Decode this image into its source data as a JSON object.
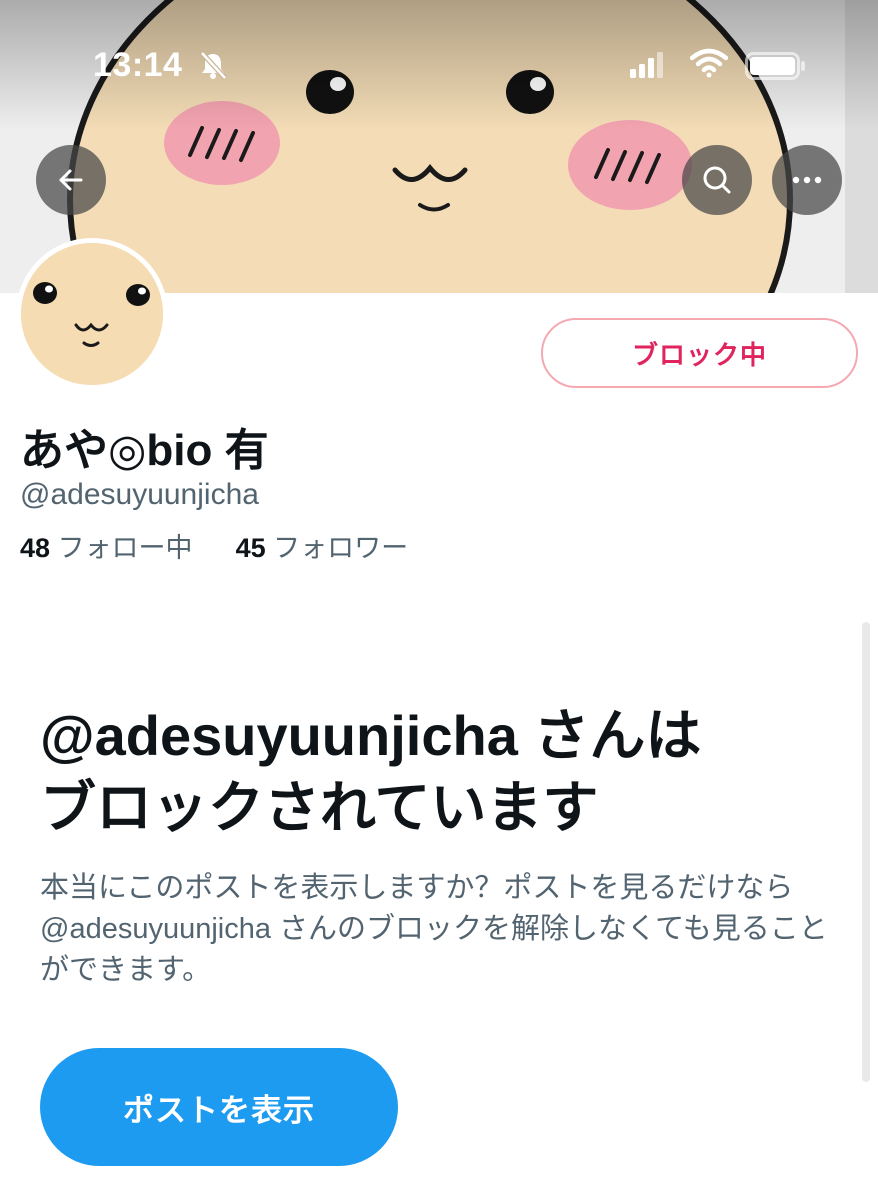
{
  "status_bar": {
    "time": "13:14",
    "icons": [
      "bell-slash-icon",
      "cellular-signal-icon",
      "wifi-icon",
      "battery-icon"
    ]
  },
  "header": {
    "icons": [
      "back-arrow-icon",
      "search-icon",
      "more-icon"
    ]
  },
  "profile": {
    "display_name": "あや◎bio 有",
    "handle": "@adesuyuunjicha",
    "following_count": "48",
    "following_label": "フォロー中",
    "followers_count": "45",
    "followers_label": "フォロワー",
    "block_button_label": "ブロック中"
  },
  "blocked_notice": {
    "title_line1": "@adesuyuunjicha さんは",
    "title_line2": "ブロックされています",
    "description": "本当にこのポストを表示しますか？ポストを見るだけなら @adesuyuunjicha さんのブロックを解除しなくても見ることができます。",
    "button_label": "ポストを表示"
  },
  "colors": {
    "accent_blue": "#1d9bf0",
    "block_red": "#e0245e",
    "block_border": "#f4a9b1",
    "text_primary": "#0f1419",
    "text_secondary": "#536471"
  }
}
